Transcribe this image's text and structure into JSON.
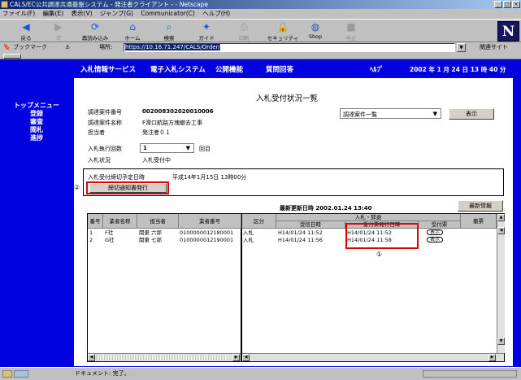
{
  "window": {
    "title": "CALS/EC公共調達共通基盤システム - 発注者クライアント - - Netscape",
    "min": "_",
    "max": "□",
    "close": "×"
  },
  "menu": [
    "ファイル(F)",
    "編集(E)",
    "表示(V)",
    "ジャンプ(G)",
    "Communicator(C)",
    "ヘルプ(H)"
  ],
  "toolbar": {
    "buttons": [
      {
        "label": "戻る",
        "icon": "◀"
      },
      {
        "label": "次",
        "icon": "▶"
      },
      {
        "label": "再読み込み",
        "icon": "⟳"
      },
      {
        "label": "ホーム",
        "icon": "⌂"
      },
      {
        "label": "検索",
        "icon": "⌕"
      },
      {
        "label": "ガイド",
        "icon": "✦"
      },
      {
        "label": "印刷",
        "icon": "⎙"
      },
      {
        "label": "セキュリティ",
        "icon": "🔒"
      },
      {
        "label": "Shop",
        "icon": "◍"
      },
      {
        "label": "中止",
        "icon": "■"
      }
    ],
    "logo": "N"
  },
  "location": {
    "bookmarks": "ブックマーク",
    "location_label": "場所:",
    "url": "https://10.16.71.247/CALS/Order/",
    "related": "関連サイト"
  },
  "topnav": {
    "items": [
      "入札情報サービス",
      "電子入札システム",
      "公開機能",
      "質問回答"
    ],
    "help": "ﾍﾙﾌﾟ",
    "datetime": "2002 年 1 月 24 日  13 時 40 分"
  },
  "sidemenu": {
    "title": "トップメニュー",
    "items": [
      "登録",
      "審査",
      "閲札",
      "進捗"
    ]
  },
  "page": {
    "title": "入札受付状況一覧",
    "fields": [
      {
        "label": "調達案件番号",
        "value": "002008302020010006"
      },
      {
        "label": "調達案件名称",
        "value": "F滑口航路方塊撤去工事"
      },
      {
        "label": "担当者",
        "value": "発注者０１"
      }
    ],
    "dropdown": {
      "value": "調達案件一覧"
    },
    "display_button": "表示",
    "round": {
      "label": "入札執行回数",
      "value": "1",
      "suffix": "回目"
    },
    "status": {
      "label": "入札状況",
      "value": "入札受付中"
    },
    "deadline": {
      "label": "入札受付締切予定日時",
      "value": "平成14年1月15日 13時00分"
    },
    "issue_button": "締切通知書発行",
    "marker2": "②",
    "updated": "最新更新日時 2002.01.24 13:40",
    "refresh_button": "最新情報",
    "left_headers": [
      "番号",
      "業者名称",
      "担当者",
      "業者番号"
    ],
    "right_headers": {
      "kubun": "区分",
      "group": "入札・辞退",
      "received": "受信日時",
      "issued": "受付票発行日時",
      "receipt": "受付票",
      "withdraw": "撤票"
    },
    "rows": [
      {
        "no": "1",
        "company": "F社",
        "person": "関東 六郎",
        "vendor_no": "0100000012180001",
        "kubun": "入札",
        "received": "H14/01/24 11:52",
        "issued": "H14/01/24 11:52",
        "receipt": "表示"
      },
      {
        "no": "2",
        "company": "G社",
        "person": "関東 七郎",
        "vendor_no": "0100000012190001",
        "kubun": "入札",
        "received": "H14/01/24 11:56",
        "issued": "H14/01/24 11:58",
        "receipt": "表示"
      }
    ],
    "marker1": "①"
  },
  "status": {
    "text": "ドキュメント: 完了。"
  }
}
